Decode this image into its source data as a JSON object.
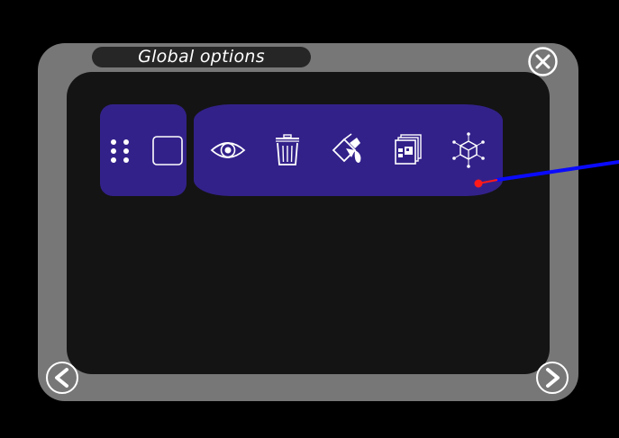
{
  "dialog": {
    "title": "Global options"
  },
  "icons": {
    "close": "close-circle-icon",
    "previous": "chevron-left-icon",
    "next": "chevron-right-icon",
    "handle": "drag-dots-icon",
    "shape": "square-outline-icon",
    "visibility": "eye-icon",
    "delete": "trash-icon",
    "paint": "paint-bucket-icon",
    "layers": "layers-icon",
    "object": "cube-network-icon"
  },
  "colors": {
    "background": "#000000",
    "frame": "#777777",
    "panel": "#141414",
    "title_bar": "#262626",
    "toolbar": "#33218a",
    "icon": "#ffffff",
    "ray": "#0a0aff",
    "pointer": "#ff1a1a"
  }
}
